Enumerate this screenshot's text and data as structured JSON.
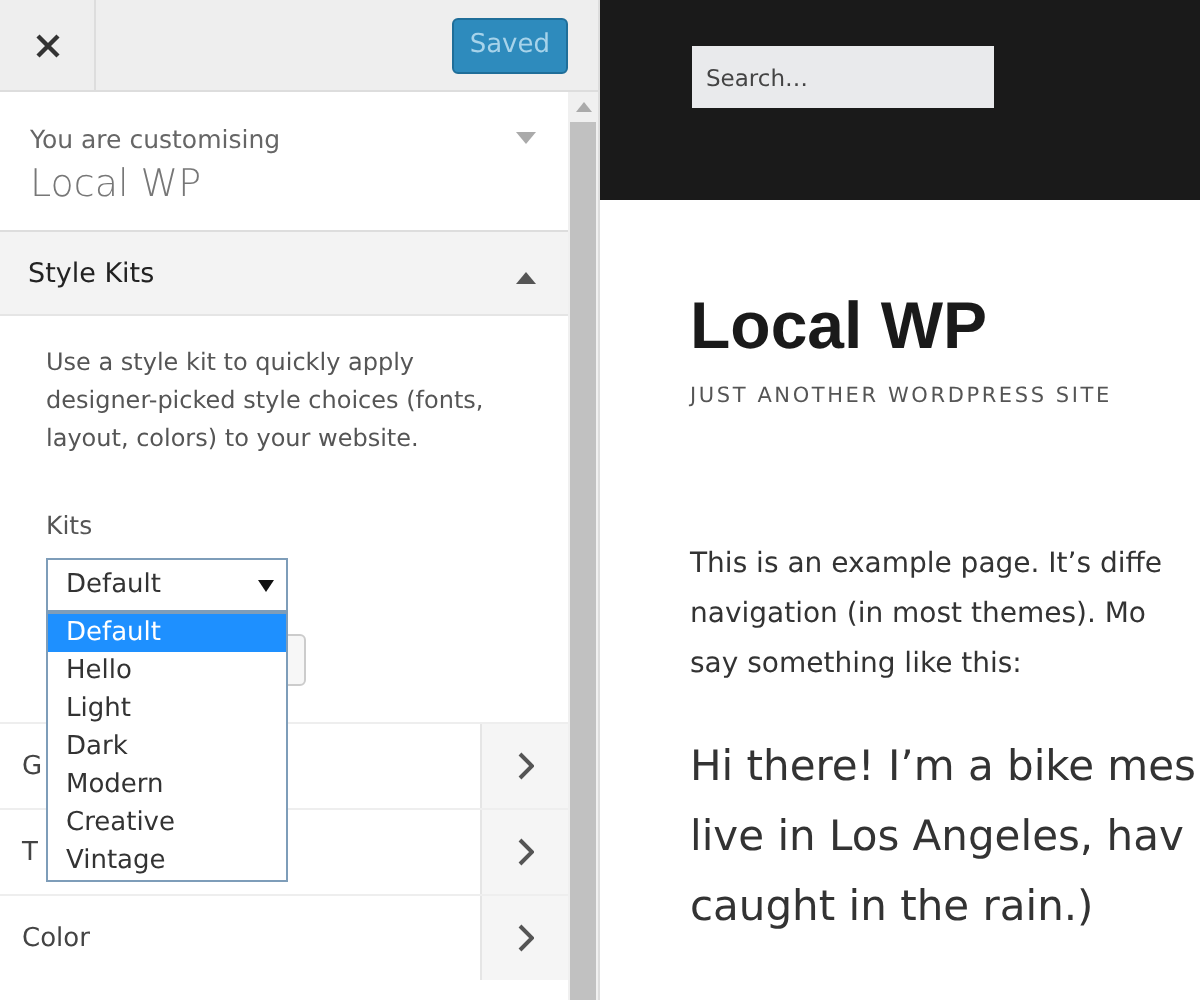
{
  "header": {
    "save_button": "Saved"
  },
  "info": {
    "label": "You are customising",
    "title": "Local WP",
    "expanded": false
  },
  "style_kits": {
    "title": "Style Kits",
    "expanded": true,
    "description": "Use a style kit to quickly apply designer-picked style choices (fonts, layout, colors) to your website.",
    "field_label": "Kits",
    "select": {
      "value": "Default",
      "open": true,
      "options": [
        {
          "label": "Default",
          "selected": true
        },
        {
          "label": "Hello",
          "selected": false
        },
        {
          "label": "Light",
          "selected": false
        },
        {
          "label": "Dark",
          "selected": false
        },
        {
          "label": "Modern",
          "selected": false
        },
        {
          "label": "Creative",
          "selected": false
        },
        {
          "label": "Vintage",
          "selected": false
        }
      ]
    }
  },
  "sections": [
    {
      "label": "G"
    },
    {
      "label": "T"
    },
    {
      "label": "Color"
    }
  ],
  "preview": {
    "search": {
      "placeholder": "Search…"
    },
    "site_title": "Local WP",
    "tagline": "JUST ANOTHER WORDPRESS SITE",
    "paragraph_lines": [
      "This is an example page. It’s diffe",
      "navigation (in most themes). Mo",
      "say something like this:"
    ],
    "quote_lines": [
      "Hi there! I’m a bike mes",
      "live in Los Angeles, hav",
      "caught in the rain.)"
    ]
  }
}
